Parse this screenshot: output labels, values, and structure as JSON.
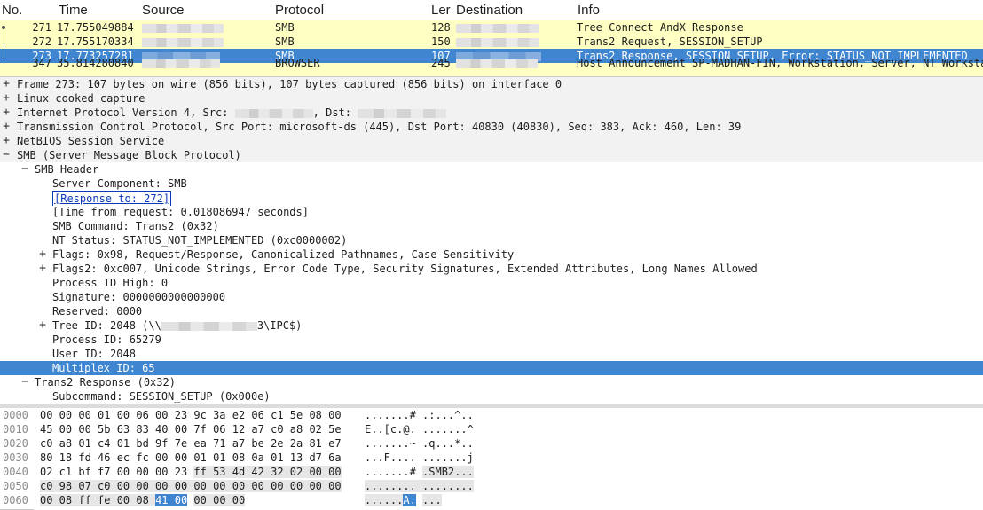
{
  "packet_list": {
    "columns": [
      "No.",
      "Time",
      "Source",
      "Protocol",
      "Ler",
      "Destination",
      "Info"
    ],
    "rows": [
      {
        "no": "271",
        "time": "17.755049884",
        "protocol": "SMB",
        "len": "128",
        "info": "Tree Connect AndX Response",
        "selected": false
      },
      {
        "no": "272",
        "time": "17.755170334",
        "protocol": "SMB",
        "len": "150",
        "info": "Trans2 Request, SESSION_SETUP",
        "selected": false
      },
      {
        "no": "273",
        "time": "17.773257281",
        "protocol": "SMB",
        "len": "107",
        "info": "Trans2 Response, SESSION_SETUP, Error: STATUS_NOT_IMPLEMENTED",
        "selected": true
      },
      {
        "no": "347",
        "time": "35.814280840",
        "protocol": "BROWSER",
        "len": "245",
        "info": "Host Announcement SP-MADHAN-FIN, Workstation, Server, NT Workstat",
        "selected": false
      }
    ]
  },
  "details": {
    "frame": "Frame 273: 107 bytes on wire (856 bits), 107 bytes captured (856 bits) on interface 0",
    "linux": "Linux cooked capture",
    "ip_prefix": "Internet Protocol Version 4, Src: ",
    "ip_dst": ", Dst: ",
    "tcp": "Transmission Control Protocol, Src Port: microsoft-ds (445), Dst Port: 40830 (40830), Seq: 383, Ack: 460, Len: 39",
    "netbios": "NetBIOS Session Service",
    "smb": "SMB (Server Message Block Protocol)",
    "smb_header": "SMB Header",
    "server_component": "Server Component: SMB",
    "response_to": "[Response to: 272]",
    "time_from_request": "[Time from request: 0.018086947 seconds]",
    "smb_command": "SMB Command: Trans2 (0x32)",
    "nt_status": "NT Status: STATUS_NOT_IMPLEMENTED (0xc0000002)",
    "flags": "Flags: 0x98, Request/Response, Canonicalized Pathnames, Case Sensitivity",
    "flags2": "Flags2: 0xc007, Unicode Strings, Error Code Type, Security Signatures, Extended Attributes, Long Names Allowed",
    "pid_high": "Process ID High: 0",
    "signature": "Signature: 0000000000000000",
    "reserved": "Reserved: 0000",
    "tree_id_prefix": "Tree ID: 2048  (\\\\",
    "tree_id_suffix": "3\\IPC$)",
    "process_id": "Process ID: 65279",
    "user_id": "User ID: 2048",
    "multiplex_id": "Multiplex ID: 65",
    "trans2_response": "Trans2 Response (0x32)",
    "subcommand": "Subcommand: SESSION_SETUP (0x000e)"
  },
  "hex": {
    "rows": [
      {
        "off": "0000",
        "b1": "00 00 00 01 00 06 00 23",
        "b2": "9c 3a e2 06 c1 5e 08 00",
        "a1": ".......#",
        "a2": ".:...^.."
      },
      {
        "off": "0010",
        "b1": "45 00 00 5b 63 83 40 00",
        "b2": "7f 06 12 a7 c0 a8 02 5e",
        "a1": "E..[c.@.",
        "a2": ".......^"
      },
      {
        "off": "0020",
        "b1": "c0 a8 01 c4 01 bd 9f 7e",
        "b2": "ea 71 a7 be 2e 2a 81 e7",
        "a1": ".......~",
        "a2": ".q...*.."
      },
      {
        "off": "0030",
        "b1": "80 18 fd 46 ec fc 00 00",
        "b2": "01 01 08 0a 01 13 d7 6a",
        "a1": "...F....",
        "a2": ".......j"
      },
      {
        "off": "0040",
        "b1": "02 c1 bf f7 00 00 00 23",
        "b2": "ff 53 4d 42 32 02 00 00",
        "a1": ".......#",
        "a2": ".SMB2..."
      },
      {
        "off": "0050",
        "b1": "c0 98 07 c0 00 00 00 00",
        "b2": "00 00 00 00 00 00 00 00",
        "a1": "........",
        "a2": "........"
      },
      {
        "off": "0060",
        "b1": "00 08 ff fe 00 08",
        "b1sel": "41 00",
        "b2": "00 00 00",
        "a1": "......",
        "a1sel": "A.",
        "a2": "..."
      }
    ]
  }
}
